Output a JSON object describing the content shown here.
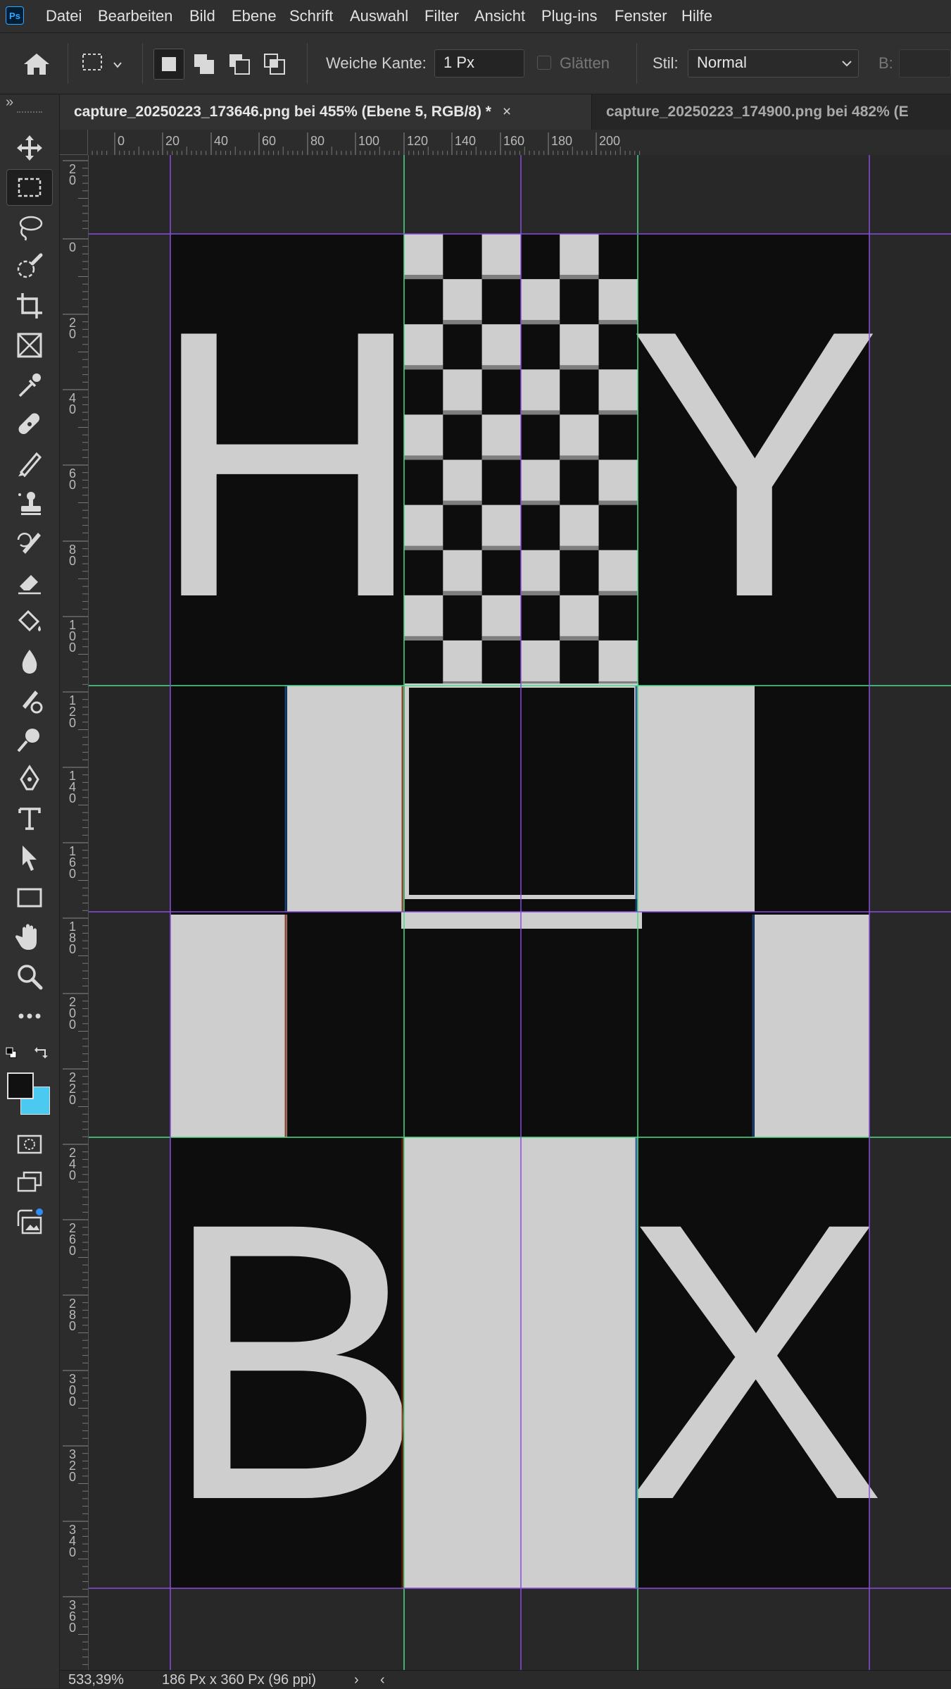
{
  "app": {
    "logo_text": "Ps"
  },
  "menu": [
    "Datei",
    "Bearbeiten",
    "Bild",
    "Ebene",
    "Schrift",
    "Auswahl",
    "Filter",
    "Ansicht",
    "Plug-ins",
    "Fenster",
    "Hilfe"
  ],
  "options": {
    "feather_label": "Weiche Kante:",
    "feather_value": "1 Px",
    "antialias_label": "Glätten",
    "style_label": "Stil:",
    "style_value": "Normal",
    "width_label": "B:"
  },
  "toolbar": {
    "collapse_glyph": "»",
    "tools": [
      "move-tool",
      "rectangular-marquee-tool",
      "lasso-tool",
      "quick-selection-tool",
      "crop-tool",
      "frame-tool",
      "eyedropper-tool",
      "spot-healing-brush-tool",
      "brush-tool",
      "clone-stamp-tool",
      "history-brush-tool",
      "eraser-tool",
      "paint-bucket-tool",
      "blur-tool",
      "dodge-tool",
      "burn-tool",
      "pen-tool",
      "type-tool",
      "path-selection-tool",
      "rectangle-tool",
      "hand-tool",
      "zoom-tool",
      "more-tools"
    ],
    "foreground_color": "#111111",
    "background_color": "#4cc9f0"
  },
  "tabs": [
    {
      "label": "capture_20250223_173646.png bei 455% (Ebene 5, RGB/8) *",
      "close": "×",
      "active": true
    },
    {
      "label": "capture_20250223_174900.png bei 482% (E",
      "active": false
    }
  ],
  "ruler_top": [
    "20",
    "0",
    "20",
    "40",
    "60",
    "80",
    "100",
    "120",
    "140",
    "160",
    "180",
    "200"
  ],
  "ruler_left": [
    [
      "2",
      "0"
    ],
    [
      "0"
    ],
    [
      "2",
      "0"
    ],
    [
      "4",
      "0"
    ],
    [
      "6",
      "0"
    ],
    [
      "8",
      "0"
    ],
    [
      "1",
      "0",
      "0"
    ],
    [
      "1",
      "2",
      "0"
    ],
    [
      "1",
      "4",
      "0"
    ],
    [
      "1",
      "6",
      "0"
    ],
    [
      "1",
      "8",
      "0"
    ],
    [
      "2",
      "0",
      "0"
    ],
    [
      "2",
      "2",
      "0"
    ],
    [
      "2",
      "4",
      "0"
    ],
    [
      "2",
      "6",
      "0"
    ],
    [
      "2",
      "8",
      "0"
    ],
    [
      "3",
      "0",
      "0"
    ],
    [
      "3",
      "2",
      "0"
    ],
    [
      "3",
      "4",
      "0"
    ],
    [
      "3",
      "6",
      "0"
    ]
  ],
  "canvas": {
    "letters": [
      "H",
      "Y",
      "B",
      "X"
    ],
    "colors": {
      "dark": "#0d0d0d",
      "light": "#cecece",
      "pasteboard": "#282828",
      "guide_green": "#4ddc8a",
      "guide_purple": "#8a4ddc"
    }
  },
  "status": {
    "zoom": "533,39%",
    "doc_info": "186 Px x 360 Px (96 ppi)",
    "next_glyph": "›",
    "prev_glyph": "‹"
  }
}
